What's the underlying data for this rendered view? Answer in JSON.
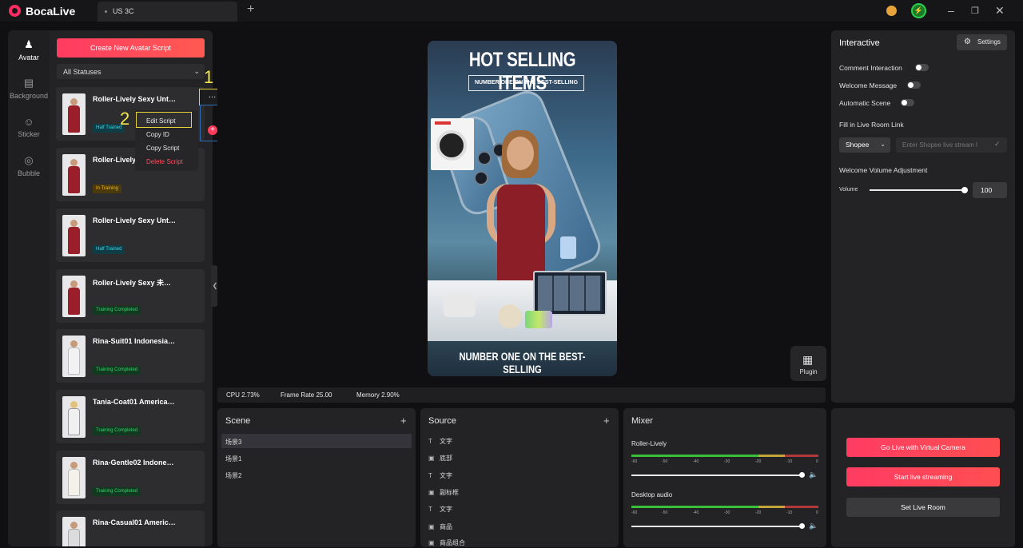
{
  "app": {
    "brand": "BocaLive",
    "tab_label": "US 3C"
  },
  "nav": [
    {
      "label": "Avatar",
      "icon": "person-icon"
    },
    {
      "label": "Background",
      "icon": "stripes-icon"
    },
    {
      "label": "Sticker",
      "icon": "sticker-icon"
    },
    {
      "label": "Bubble",
      "icon": "bubble-icon"
    }
  ],
  "scripts": {
    "create_label": "Create New Avatar Script",
    "status_filter": "All Statuses",
    "items": [
      {
        "name": "Roller-Lively Sexy Unt…",
        "status": "Half Trained"
      },
      {
        "name": "Roller-Lively",
        "status": "In Training"
      },
      {
        "name": "Roller-Lively Sexy Unt…",
        "status": "Half Trained"
      },
      {
        "name": "Roller-Lively Sexy 未…",
        "status": "Training Completed"
      },
      {
        "name": "Rina-Suit01 Indonesia…",
        "status": "Training Completed"
      },
      {
        "name": "Tania-Coat01 America…",
        "status": "Training Completed"
      },
      {
        "name": "Rina-Gentle02 Indone…",
        "status": "Training Completed"
      },
      {
        "name": "Rina-Casual01 Americ…",
        "status": ""
      }
    ]
  },
  "context_menu": {
    "more": "…",
    "items": [
      "Edit Script",
      "Copy ID",
      "Copy Script",
      "Delete Script"
    ]
  },
  "annotations": [
    "1",
    "2"
  ],
  "poster": {
    "title": "HOT SELLING ITEMS",
    "subtitle": "NUMBER ONE ON THE BEST-SELLING",
    "footer": "NUMBER ONE ON THE BEST-SELLING"
  },
  "plugin_label": "Plugin",
  "stats": {
    "cpu": "CPU 2.73%",
    "frame_rate": "Frame Rate 25.00",
    "memory": "Memory 2.90%"
  },
  "scene": {
    "title": "Scene",
    "items": [
      "场景3",
      "场景1",
      "场景2"
    ]
  },
  "source": {
    "title": "Source",
    "items": [
      {
        "label": "文字",
        "icon": "text-icon"
      },
      {
        "label": "底部",
        "icon": "image-icon"
      },
      {
        "label": "文字",
        "icon": "text-icon"
      },
      {
        "label": "副标框",
        "icon": "image-icon"
      },
      {
        "label": "文字",
        "icon": "text-icon"
      },
      {
        "label": "商品",
        "icon": "image-icon"
      },
      {
        "label": "商品组合",
        "icon": "image-icon"
      }
    ]
  },
  "mixer": {
    "title": "Mixer",
    "channels": [
      {
        "name": "Roller-Lively",
        "volume": 1.0
      },
      {
        "name": "Desktop audio",
        "volume": 1.0
      }
    ],
    "ticks": [
      "-60",
      "-50",
      "-40",
      "-30",
      "-20",
      "-10",
      "0"
    ]
  },
  "interactive": {
    "title": "Interactive",
    "settings": "Settings",
    "toggles": [
      {
        "label": "Comment Interaction",
        "on": false
      },
      {
        "label": "Welcome Message",
        "on": false
      },
      {
        "label": "Automatic Scene",
        "on": false
      }
    ],
    "link_label": "Fill in Live Room Link",
    "platform": "Shopee",
    "link_placeholder": "Enter Shopee live stream l",
    "volume_title": "Welcome Volume Adjustment",
    "volume_label": "Volume",
    "volume_value": "100"
  },
  "live": {
    "virtual_camera": "Go Live with Virtual Camera",
    "start": "Start live streaming",
    "set_room": "Set Live Room"
  },
  "colors": {
    "accent": "#ff3b62",
    "highlight": "#e5d43a"
  }
}
